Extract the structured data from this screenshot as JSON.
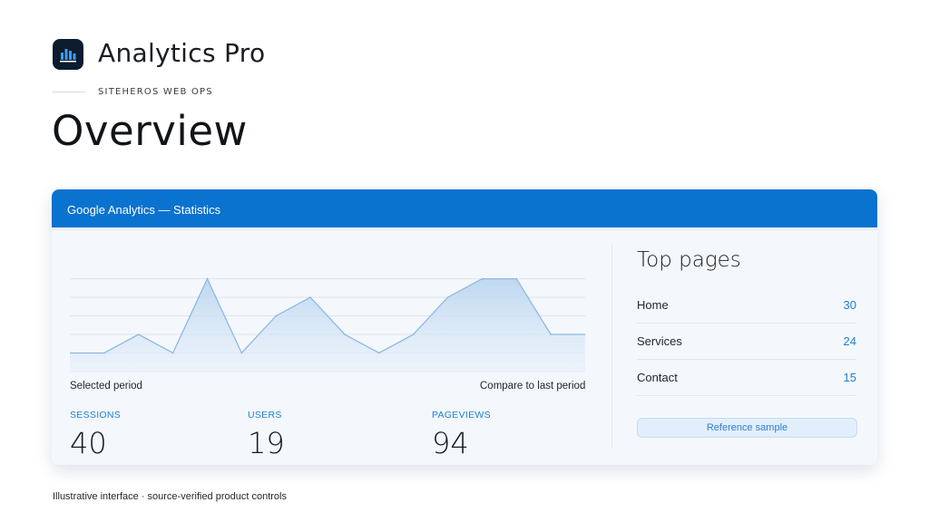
{
  "app": {
    "title": "Analytics Pro",
    "icon": "bar-chart-icon",
    "eyebrow": "SITEHEROS WEB OPS",
    "page_title": "Overview"
  },
  "card": {
    "header": "Google Analytics — Statistics",
    "legend_selected": "Selected period",
    "legend_compare": "Compare to last period",
    "accent_color": "#0a72cf",
    "stats": [
      {
        "label": "SESSIONS",
        "value": "40"
      },
      {
        "label": "USERS",
        "value": "19"
      },
      {
        "label": "PAGEVIEWS",
        "value": "94"
      }
    ],
    "top_pages": {
      "title": "Top pages",
      "items": [
        {
          "label": "Home",
          "count": "30"
        },
        {
          "label": "Services",
          "count": "24"
        },
        {
          "label": "Contact",
          "count": "15"
        }
      ]
    },
    "reference_button": "Reference sample"
  },
  "chart_data": {
    "type": "area",
    "x": [
      1,
      2,
      3,
      4,
      5,
      6,
      7,
      8,
      9,
      10,
      11,
      12,
      13,
      14,
      15,
      16
    ],
    "series": [
      {
        "values": [
          4,
          4,
          5,
          4,
          8,
          4,
          6,
          7,
          5,
          4,
          5,
          7,
          8,
          8,
          5,
          5
        ]
      }
    ],
    "ylim": [
      3,
      8
    ],
    "grid": true
  },
  "footnote": "Illustrative interface · source-verified product controls"
}
